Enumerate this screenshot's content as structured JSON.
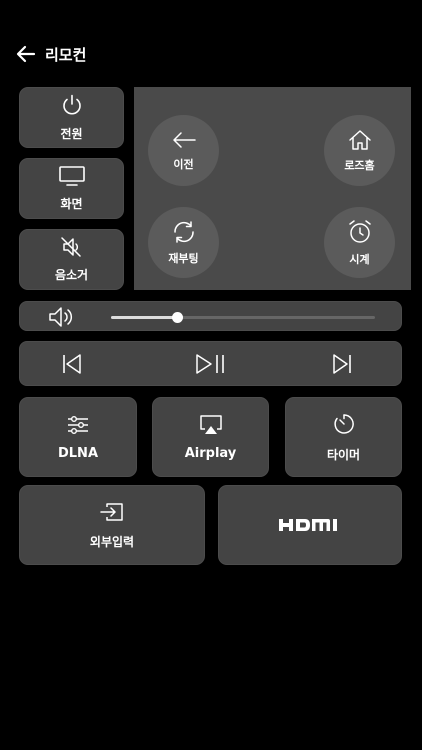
{
  "header": {
    "title": "리모컨",
    "back_icon": "arrow-left-icon"
  },
  "left_buttons": [
    {
      "label": "전원",
      "icon": "power-icon"
    },
    {
      "label": "화면",
      "icon": "monitor-icon"
    },
    {
      "label": "음소거",
      "icon": "mute-icon"
    }
  ],
  "nav_pad": [
    {
      "label": "이전",
      "icon": "back-arrow-icon"
    },
    {
      "label": "로즈홈",
      "icon": "home-icon"
    },
    {
      "label": "재부팅",
      "icon": "reboot-icon"
    },
    {
      "label": "시계",
      "icon": "alarm-clock-icon"
    }
  ],
  "volume": {
    "icon": "speaker-icon",
    "level": 0.25
  },
  "media": {
    "prev_icon": "skip-previous-icon",
    "play_icon": "play-pause-icon",
    "next_icon": "skip-next-icon"
  },
  "grid": [
    {
      "label": "DLNA",
      "icon": "sliders-icon"
    },
    {
      "label": "Airplay",
      "icon": "airplay-icon"
    },
    {
      "label": "타이머",
      "icon": "timer-icon"
    }
  ],
  "inputs": [
    {
      "label": "외부입력",
      "icon": "input-source-icon"
    },
    {
      "label": "HDMI",
      "icon": "hdmi-logo"
    }
  ],
  "colors": {
    "background": "#000000",
    "tile": "#444444",
    "pad": "#4a4a4a",
    "circle": "#5b5b5b",
    "text": "#ffffff"
  }
}
